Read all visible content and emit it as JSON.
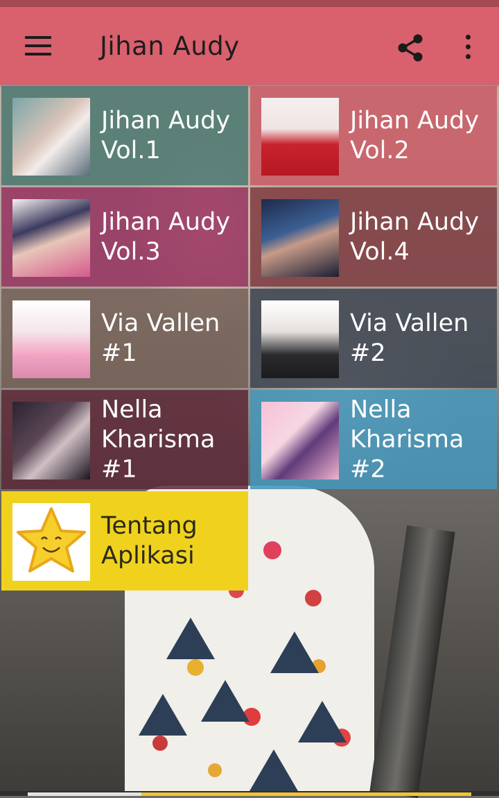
{
  "app": {
    "title": "Jihan Audy",
    "menu_icon": "hamburger-menu-icon",
    "share_icon": "share-icon",
    "more_icon": "more-vert-icon"
  },
  "colors": {
    "statusbar": "#a54a55",
    "appbar": "#d9606d",
    "accent_yellow": "#f0d21e"
  },
  "tiles": [
    {
      "label": "Jihan Audy\nVol.1",
      "color": "rgba(74,120,112,0.85)",
      "thumb": "jihan-audy-vol1-cover"
    },
    {
      "label": "Jihan Audy\nVol.2",
      "color": "rgba(202,90,100,0.85)",
      "thumb": "jihan-audy-vol2-cover"
    },
    {
      "label": "Jihan Audy\nVol.3",
      "color": "rgba(150,50,95,0.85)",
      "thumb": "jihan-audy-vol3-cover"
    },
    {
      "label": "Jihan Audy\nVol.4",
      "color": "rgba(125,55,60,0.82)",
      "thumb": "jihan-audy-vol4-cover"
    },
    {
      "label": "Via Vallen\n#1",
      "color": "rgba(112,92,82,0.8)",
      "thumb": "via-vallen-1-cover"
    },
    {
      "label": "Via Vallen\n#2",
      "color": "rgba(60,68,80,0.85)",
      "thumb": "via-vallen-2-cover"
    },
    {
      "label": "Nella\nKharisma\n#1",
      "color": "rgba(92,40,55,0.85)",
      "thumb": "nella-kharisma-1-cover"
    },
    {
      "label": "Nella\nKharisma\n#2",
      "color": "rgba(70,150,185,0.88)",
      "thumb": "nella-kharisma-2-cover"
    },
    {
      "label": "Tentang\nAplikasi",
      "color": "#f0d21e",
      "thumb": "star-smile-icon"
    }
  ]
}
